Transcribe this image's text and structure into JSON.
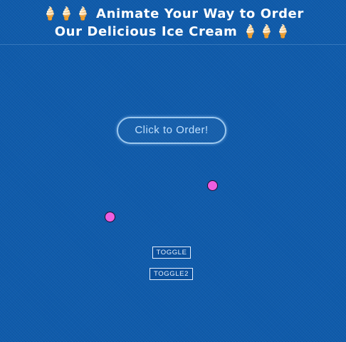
{
  "header": {
    "title_line1": "🍦🍦🍦 Animate Your Way to Order",
    "title_line2": "Our Delicious Ice Cream 🍦🍦🍦"
  },
  "main": {
    "order_button_label": "Click to Order!",
    "toggle_label": "TOGGLE",
    "toggle2_label": "TOGGLE2"
  },
  "colors": {
    "background": "#0f5bab",
    "dot_fill": "#ee5ee0",
    "button_border": "#9cc8ee",
    "title_text": "#ffffff"
  }
}
